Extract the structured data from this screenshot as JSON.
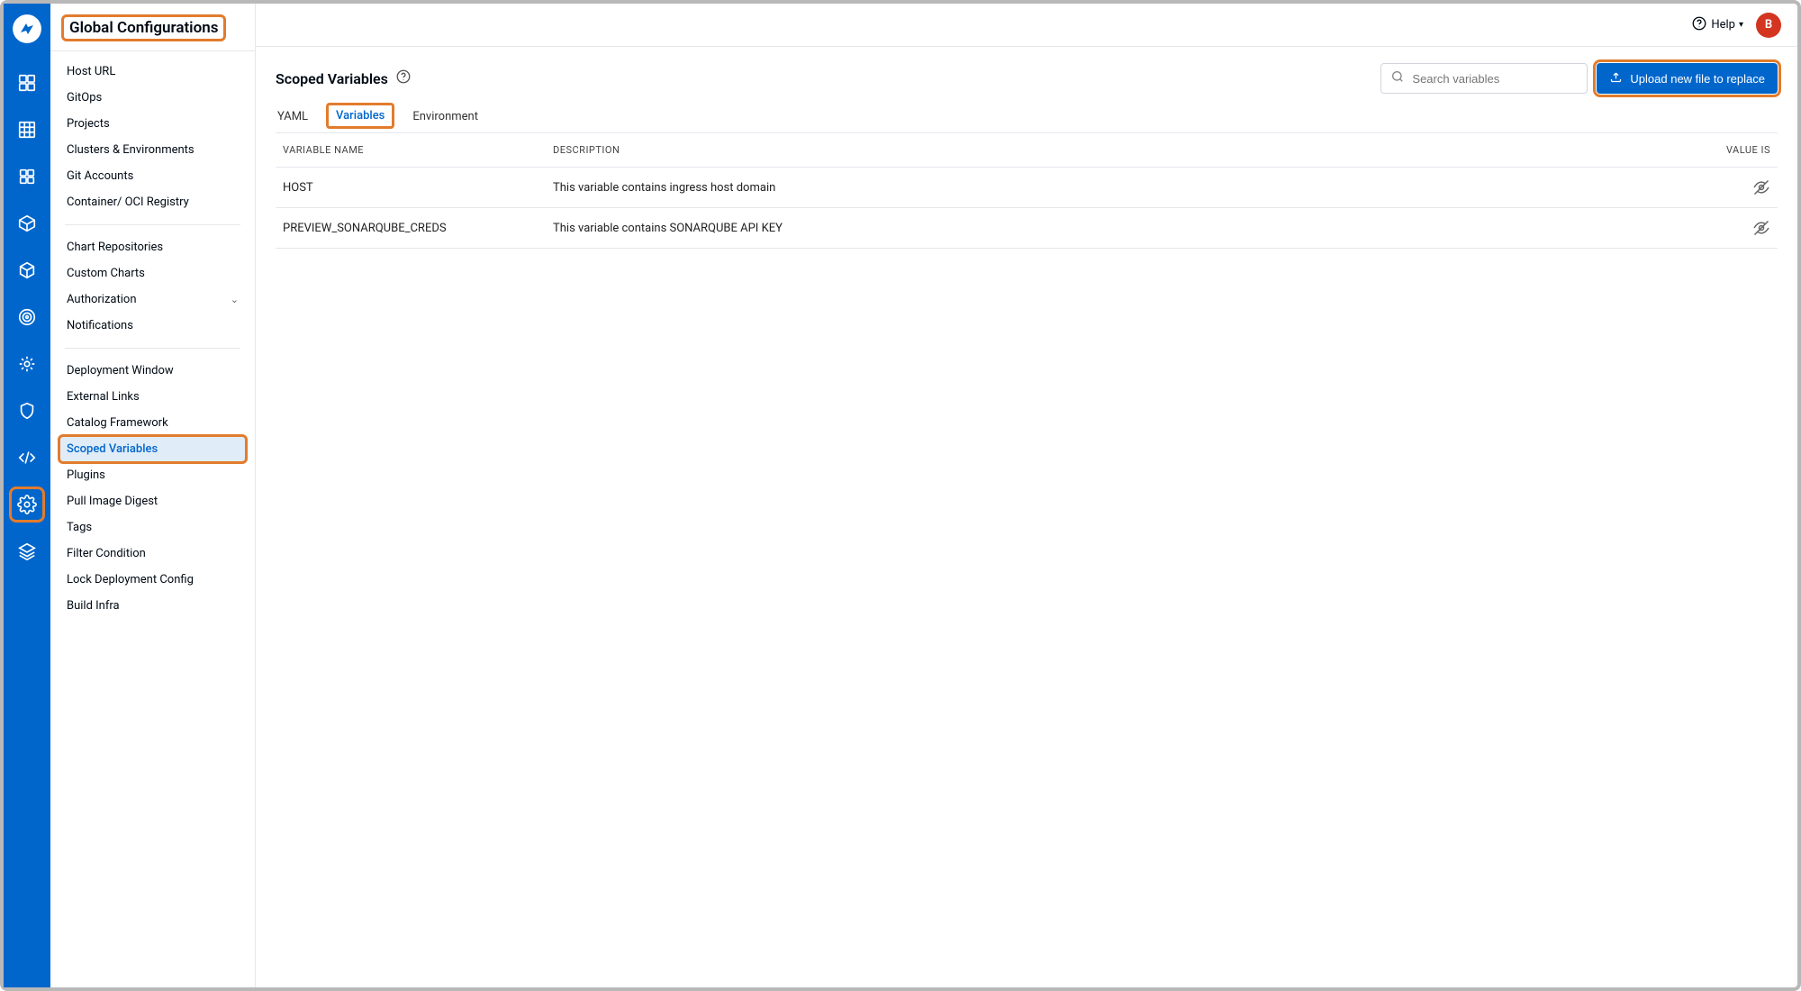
{
  "header": {
    "help_label": "Help",
    "avatar_initial": "B"
  },
  "sidebar": {
    "title": "Global Configurations",
    "groups": [
      {
        "items": [
          {
            "label": "Host URL"
          },
          {
            "label": "GitOps"
          },
          {
            "label": "Projects"
          },
          {
            "label": "Clusters & Environments"
          },
          {
            "label": "Git Accounts"
          },
          {
            "label": "Container/ OCI Registry"
          }
        ]
      },
      {
        "items": [
          {
            "label": "Chart Repositories"
          },
          {
            "label": "Custom Charts"
          },
          {
            "label": "Authorization",
            "expandable": true
          },
          {
            "label": "Notifications"
          }
        ]
      },
      {
        "items": [
          {
            "label": "Deployment Window"
          },
          {
            "label": "External Links"
          },
          {
            "label": "Catalog Framework"
          },
          {
            "label": "Scoped Variables",
            "active": true
          },
          {
            "label": "Plugins"
          },
          {
            "label": "Pull Image Digest"
          },
          {
            "label": "Tags"
          },
          {
            "label": "Filter Condition"
          },
          {
            "label": "Lock Deployment Config"
          },
          {
            "label": "Build Infra"
          }
        ]
      }
    ]
  },
  "icon_rail": [
    "logo",
    "dashboard",
    "grid-alt",
    "apps",
    "package",
    "cube",
    "target",
    "helm",
    "shield",
    "code",
    "settings",
    "layers"
  ],
  "main": {
    "title": "Scoped Variables",
    "search_placeholder": "Search variables",
    "upload_button_label": "Upload new file to replace",
    "tabs": [
      {
        "label": "YAML",
        "active": false
      },
      {
        "label": "Variables",
        "active": true
      },
      {
        "label": "Environment",
        "active": false
      }
    ],
    "columns": {
      "name": "VARIABLE NAME",
      "description": "DESCRIPTION",
      "value": "VALUE IS"
    },
    "rows": [
      {
        "name": "HOST",
        "description": "This variable contains ingress host domain"
      },
      {
        "name": "PREVIEW_SONARQUBE_CREDS",
        "description": "This variable contains SONARQUBE API KEY"
      }
    ]
  }
}
